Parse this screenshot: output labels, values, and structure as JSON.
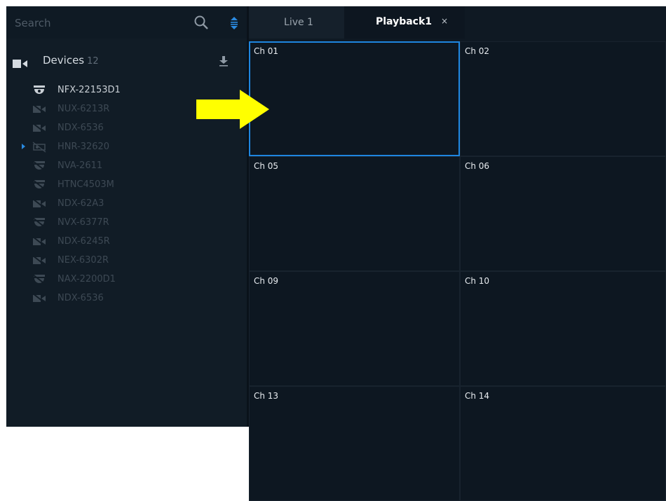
{
  "search": {
    "placeholder": "Search",
    "icon": "search-icon",
    "sort_icon": "sort-icon"
  },
  "devices": {
    "title": "Devices",
    "count": "12",
    "items": [
      {
        "label": "NFX-22153D1",
        "icon": "dome-camera-icon",
        "state": "online"
      },
      {
        "label": "NUX-6213R",
        "icon": "camera-offline-icon",
        "state": "offline"
      },
      {
        "label": "NDX-6536",
        "icon": "camera-offline-icon",
        "state": "offline"
      },
      {
        "label": "HNR-32620",
        "icon": "recorder-offline-icon",
        "state": "offline",
        "expandable": true
      },
      {
        "label": "NVA-2611",
        "icon": "dome-offline-icon",
        "state": "offline"
      },
      {
        "label": "HTNC4503M",
        "icon": "dome-offline-icon",
        "state": "offline"
      },
      {
        "label": "NDX-62A3",
        "icon": "camera-offline-icon",
        "state": "offline"
      },
      {
        "label": "NVX-6377R",
        "icon": "dome-offline-icon",
        "state": "offline"
      },
      {
        "label": "NDX-6245R",
        "icon": "camera-offline-icon",
        "state": "offline"
      },
      {
        "label": "NEX-6302R",
        "icon": "camera-offline-icon",
        "state": "offline"
      },
      {
        "label": "NAX-2200D1",
        "icon": "dome-offline-icon",
        "state": "offline"
      },
      {
        "label": "NDX-6536",
        "icon": "camera-offline-icon",
        "state": "offline"
      }
    ]
  },
  "tabs": [
    {
      "label": "Live 1",
      "active": false
    },
    {
      "label": "Playback1",
      "active": true,
      "close": "×"
    }
  ],
  "grid": {
    "cells": [
      "Ch 01",
      "Ch 02",
      "Ch 05",
      "Ch 06",
      "Ch 09",
      "Ch 10",
      "Ch 13",
      "Ch 14"
    ],
    "selected": "Ch 01"
  },
  "colors": {
    "accent": "#1e86e0",
    "background": "#0f1923",
    "arrow": "#ffff00"
  }
}
